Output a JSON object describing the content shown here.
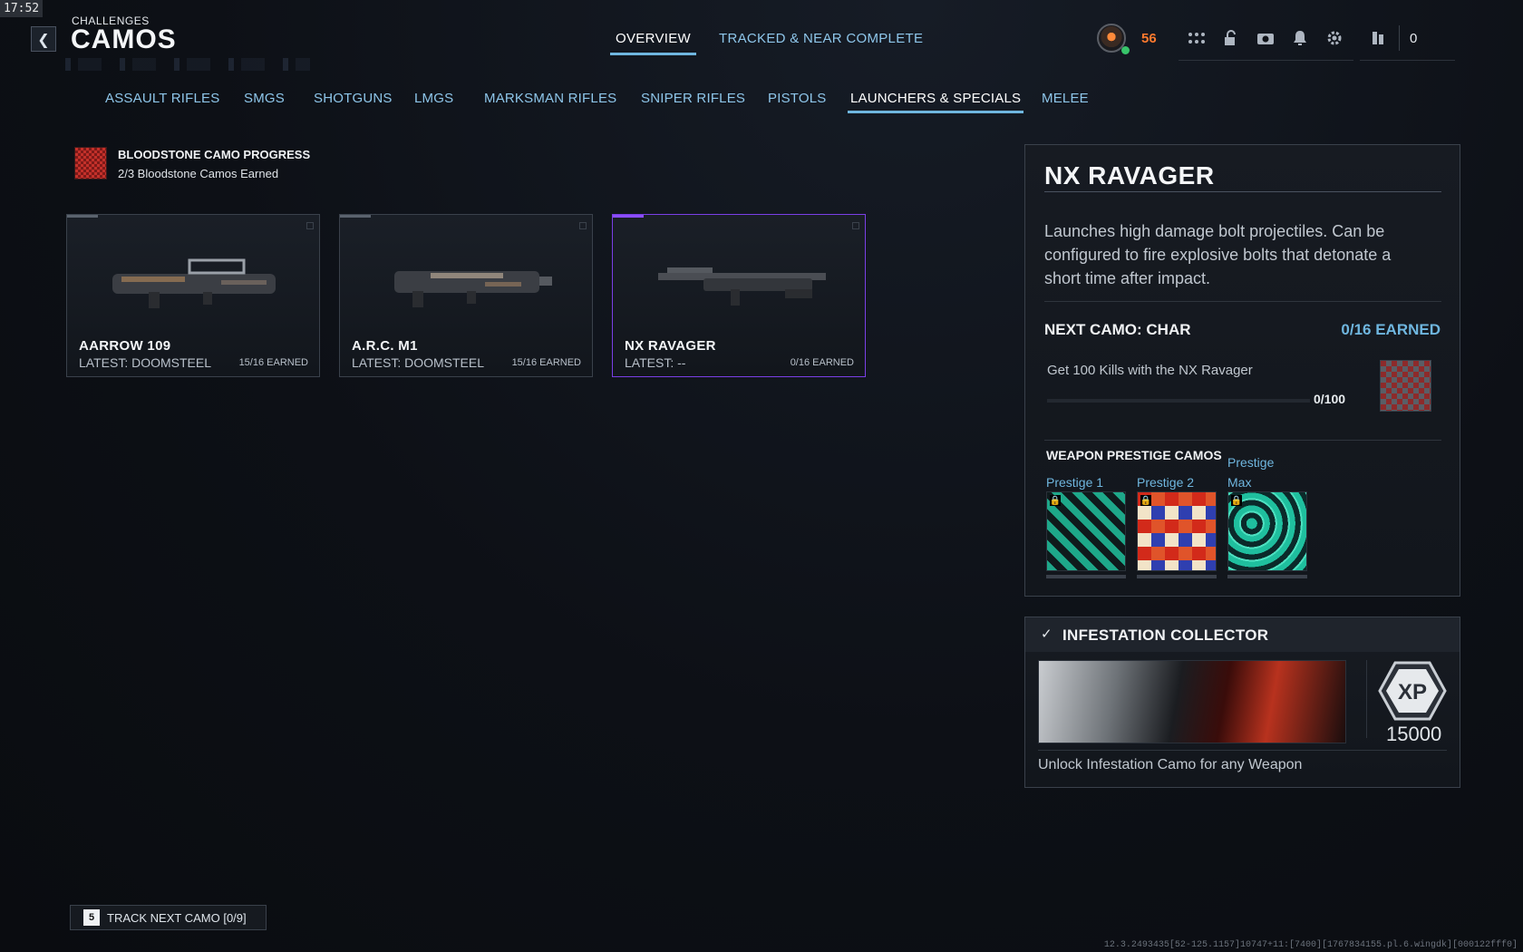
{
  "clock": "17:52",
  "header": {
    "breadcrumb": "CHALLENGES",
    "title": "CAMOS",
    "tabs": [
      {
        "label": "OVERVIEW",
        "active": true
      },
      {
        "label": "TRACKED & NEAR COMPLETE",
        "active": false
      }
    ],
    "player_level": "56",
    "currency": "0",
    "icons": [
      "apps-grid-icon",
      "unlock-icon",
      "camera-icon",
      "bell-icon",
      "gear-icon",
      "operator-icon"
    ]
  },
  "categories": [
    {
      "label": "ASSAULT RIFLES",
      "active": false
    },
    {
      "label": "SMGS",
      "active": false
    },
    {
      "label": "SHOTGUNS",
      "active": false
    },
    {
      "label": "LMGS",
      "active": false
    },
    {
      "label": "MARKSMAN RIFLES",
      "active": false
    },
    {
      "label": "SNIPER RIFLES",
      "active": false
    },
    {
      "label": "PISTOLS",
      "active": false
    },
    {
      "label": "LAUNCHERS & SPECIALS",
      "active": true
    },
    {
      "label": "MELEE",
      "active": false
    }
  ],
  "bloodstone": {
    "title": "BLOODSTONE CAMO PROGRESS",
    "subtitle": "2/3 Bloodstone Camos Earned"
  },
  "weapons": [
    {
      "name": "AARROW 109",
      "latest": "LATEST: DOOMSTEEL",
      "earned": "15/16 EARNED",
      "selected": false
    },
    {
      "name": "A.R.C. M1",
      "latest": "LATEST: DOOMSTEEL",
      "earned": "15/16 EARNED",
      "selected": false
    },
    {
      "name": "NX RAVAGER",
      "latest": "LATEST: --",
      "earned": "0/16 EARNED",
      "selected": true
    }
  ],
  "detail": {
    "title": "NX RAVAGER",
    "description": "Launches high damage bolt projectiles. Can be configured to fire explosive bolts that detonate a short time after impact.",
    "next_camo": "NEXT CAMO: CHAR",
    "next_earned": "0/16 EARNED",
    "challenge": "Get 100 Kills with the NX Ravager",
    "challenge_progress": "0/100",
    "challenge_fraction": 0,
    "prestige_heading": "WEAPON PRESTIGE CAMOS",
    "prestige": [
      {
        "label": "Prestige 1"
      },
      {
        "label": "Prestige 2"
      },
      {
        "label_line1": "Prestige",
        "label_line2": "Max"
      }
    ]
  },
  "infestation": {
    "title": "INFESTATION COLLECTOR",
    "xp_badge": "XP",
    "xp_value": "15000",
    "description": "Unlock Infestation Camo for any Weapon"
  },
  "footer": {
    "track_key": "5",
    "track_label": "TRACK NEXT CAMO [0/9]",
    "build": "12.3.2493435[52-125.1157]10747+11:[7400][1767834155.pl.6.wingdk][000122fff0]"
  },
  "colors": {
    "accent_blue": "#6fb6df",
    "selected_purple": "#7a3fe6",
    "level_orange": "#ff7a2e"
  }
}
